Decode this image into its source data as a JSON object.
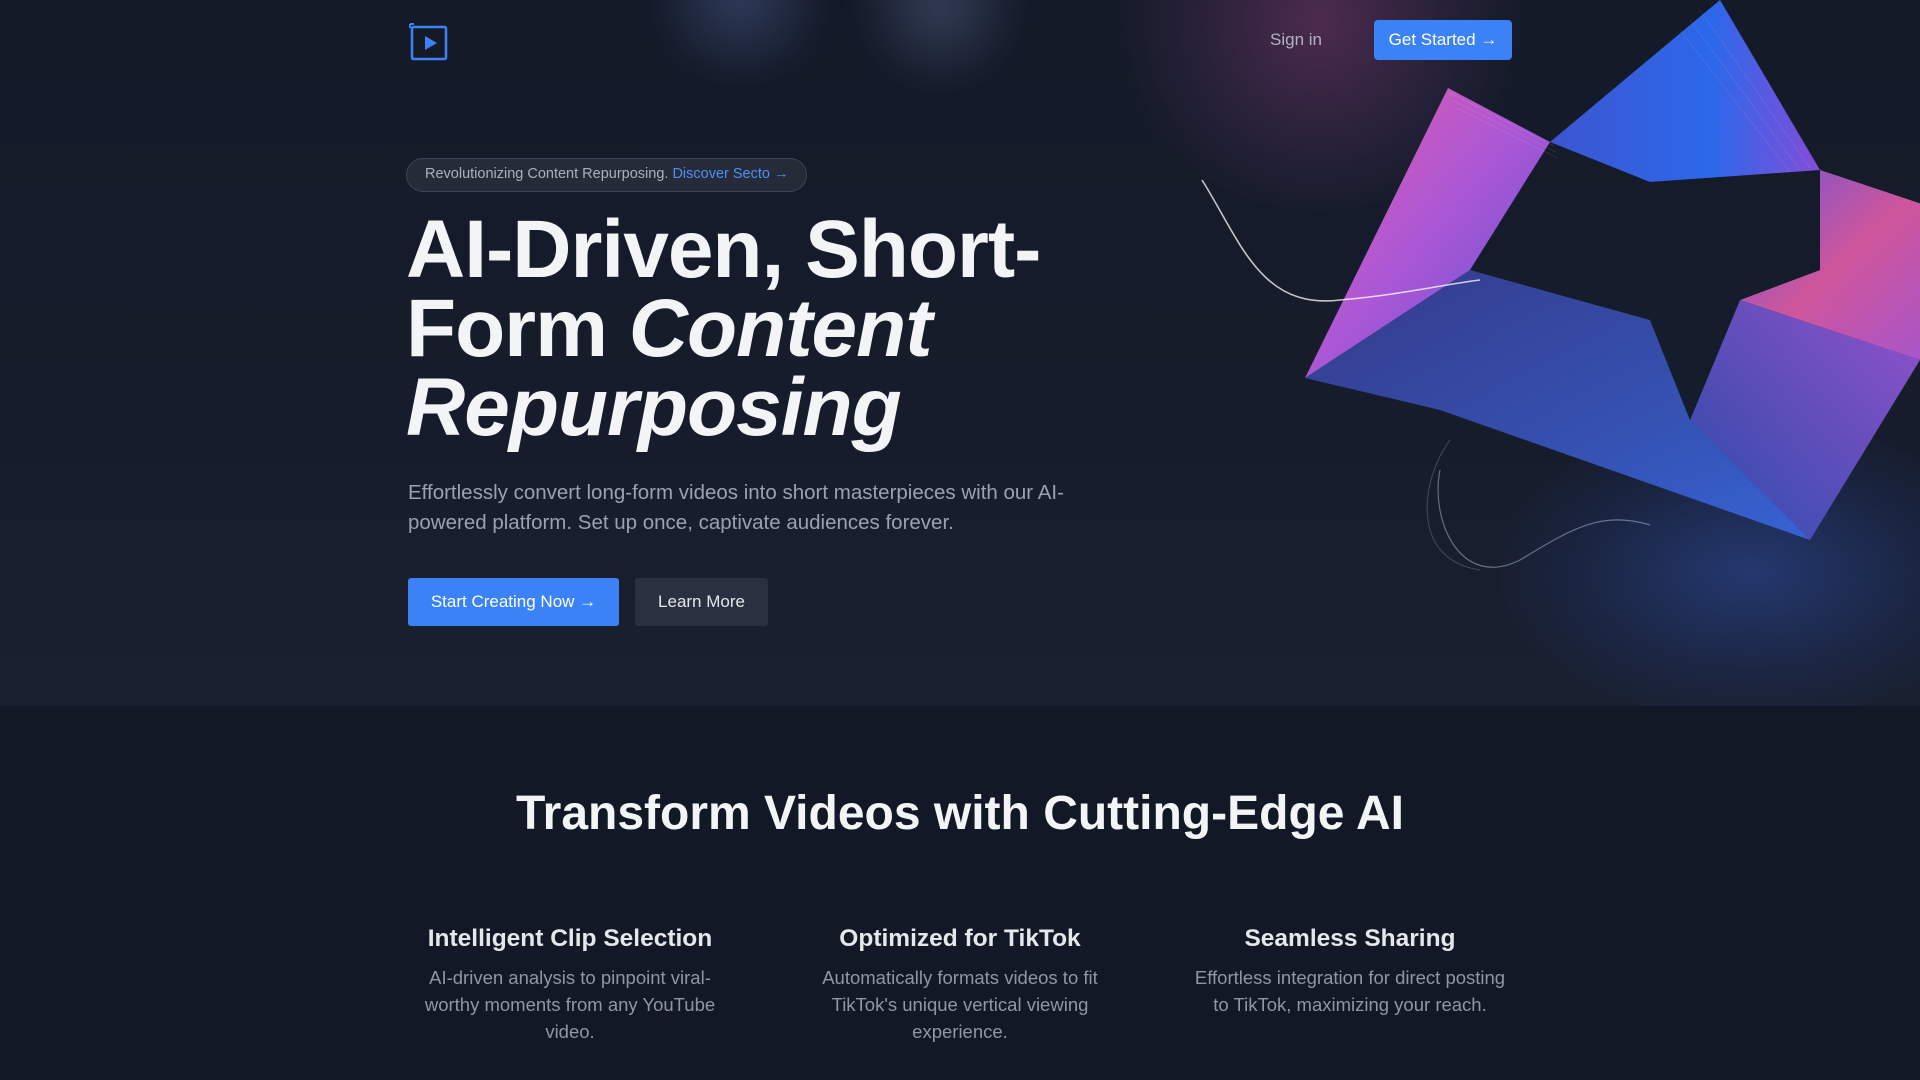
{
  "colors": {
    "accent": "#3b82f6",
    "hero_bg": "#161c2b",
    "section_bg": "#121826",
    "secondary_button": "#293140"
  },
  "nav": {
    "logo_icon": "play-box-icon",
    "sign_in_label": "Sign in",
    "get_started_label": "Get Started →"
  },
  "hero": {
    "pill_text": "Revolutionizing Content Repurposing.",
    "pill_link": "Discover Secto →",
    "headline": {
      "line1": "AI-Driven, Short-",
      "line2_plain": "Form ",
      "line2_italic": "Content",
      "line3_italic": "Repurposing"
    },
    "subtitle": "Effortlessly convert long-form videos into short masterpieces with our AI-powered platform. Set up once, captivate audiences forever.",
    "primary_cta": "Start Creating Now →",
    "secondary_cta": "Learn More"
  },
  "features_section": {
    "title": "Transform Videos with Cutting-Edge AI",
    "items": [
      {
        "title": "Intelligent Clip Selection",
        "description": "AI-driven analysis to pinpoint viral-worthy moments from any YouTube video."
      },
      {
        "title": "Optimized for TikTok",
        "description": "Automatically formats videos to fit TikTok's unique vertical viewing experience."
      },
      {
        "title": "Seamless Sharing",
        "description": "Effortless integration for direct posting to TikTok, maximizing your reach."
      }
    ]
  }
}
